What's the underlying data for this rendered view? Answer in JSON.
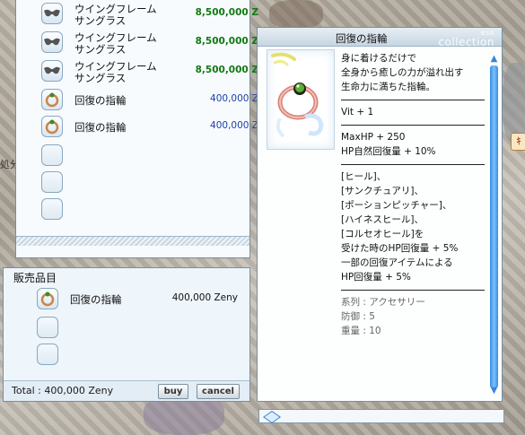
{
  "shop": {
    "items": [
      {
        "name": "ウイングフレームサングラス",
        "price": "8,500,000 Z",
        "icon": "sunglasses-icon",
        "price_color": "green"
      },
      {
        "name": "ウイングフレームサングラス",
        "price": "8,500,000 Z",
        "icon": "sunglasses-icon",
        "price_color": "green"
      },
      {
        "name": "ウイングフレームサングラス",
        "price": "8,500,000 Z",
        "icon": "sunglasses-icon",
        "price_color": "green"
      },
      {
        "name": "回復の指輪",
        "price": "400,000 Z",
        "icon": "ring-icon",
        "price_color": "blue"
      },
      {
        "name": "回復の指輪",
        "price": "400,000 Z",
        "icon": "ring-icon",
        "price_color": "blue"
      }
    ]
  },
  "sale": {
    "title": "販売品目",
    "items": [
      {
        "name": "回復の指輪",
        "price": "400,000 Zeny",
        "icon": "ring-icon"
      }
    ],
    "total": "Total : 400,000 Zeny",
    "buy_label": "buy",
    "cancel_label": "cancel"
  },
  "description": {
    "title": "回復の指輪",
    "watermark_small": "eso",
    "watermark": "collection",
    "lines": {
      "l1": "身に着けるだけで",
      "l2": "全身から癒しの力が溢れ出す",
      "l3": "生命力に満ちた指輪。",
      "vit": "Vit + 1",
      "maxhp": "MaxHP + 250",
      "hpregen": "HP自然回復量 + 10%",
      "s1": "[ヒール]、",
      "s2": "[サンクチュアリ]、",
      "s3": "[ポーションピッチャー]、",
      "s4": "[ハイネスヒール]、",
      "s5": "[コルセオヒール]を",
      "s6": "受けた時のHP回復量 + 5%",
      "s7": "一部の回復アイテムによる",
      "s8": "HP回復量 + 5%",
      "type": "系列 : アクセサリー",
      "def": "防御 : 5",
      "weight": "重量 : 10"
    }
  },
  "side": {
    "left_label": "処分",
    "badge": "ｷ"
  },
  "colors": {
    "green_price": "#117a11",
    "blue_price": "#1d3fa8",
    "scroll_thumb": "#3a8de0"
  }
}
